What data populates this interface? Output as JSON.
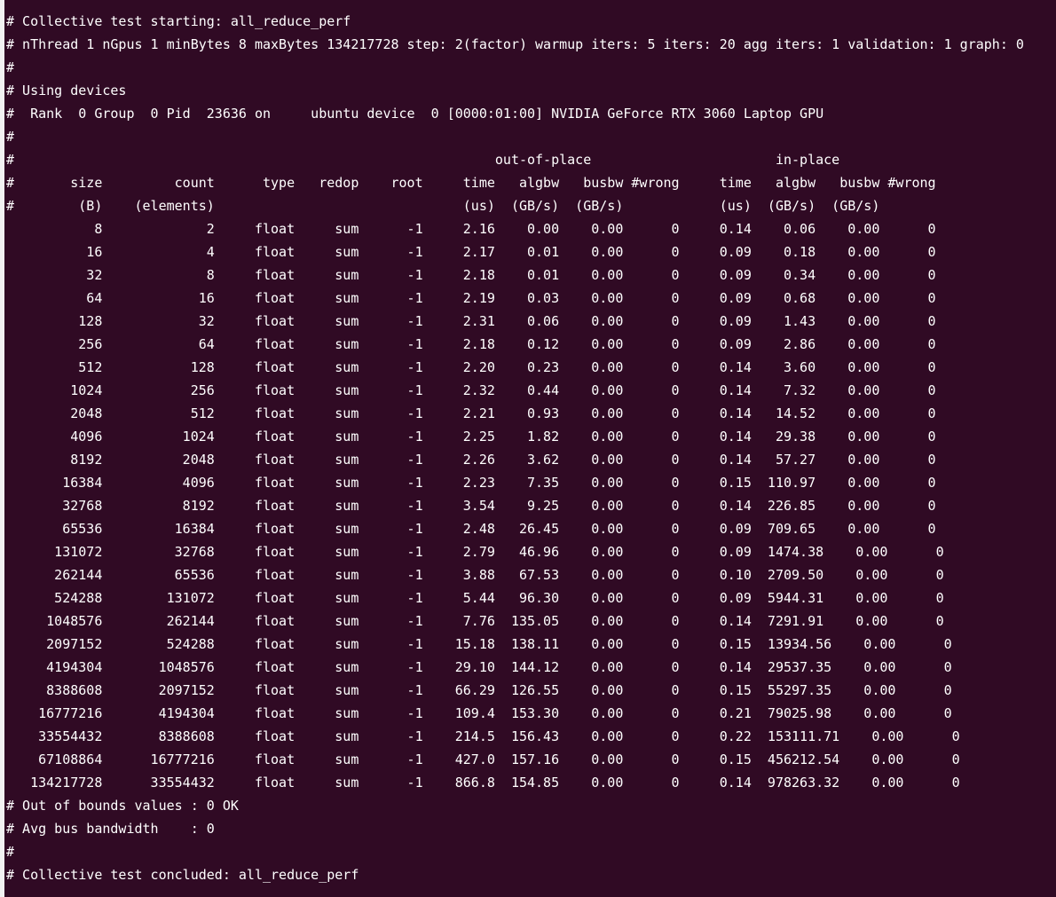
{
  "terminal": {
    "background": "#300a24",
    "foreground": "#ffffff",
    "lines": [
      "# Collective test starting: all_reduce_perf",
      "# nThread 1 nGpus 1 minBytes 8 maxBytes 134217728 step: 2(factor) warmup iters: 5 iters: 20 agg iters: 1 validation: 1 graph: 0",
      "#",
      "# Using devices",
      "#  Rank  0 Group  0 Pid  23636 on     ubuntu device  0 [0000:01:00] NVIDIA GeForce RTX 3060 Laptop GPU",
      "#",
      "#                                                            out-of-place                       in-place",
      "#       size         count      type   redop    root     time   algbw   busbw #wrong     time   algbw   busbw #wrong",
      "#        (B)    (elements)                               (us)  (GB/s)  (GB/s)            (us)  (GB/s)  (GB/s)",
      "           8             2     float     sum      -1     2.16    0.00    0.00      0     0.14    0.06    0.00      0",
      "          16             4     float     sum      -1     2.17    0.01    0.00      0     0.09    0.18    0.00      0",
      "          32             8     float     sum      -1     2.18    0.01    0.00      0     0.09    0.34    0.00      0",
      "          64            16     float     sum      -1     2.19    0.03    0.00      0     0.09    0.68    0.00      0",
      "         128            32     float     sum      -1     2.31    0.06    0.00      0     0.09    1.43    0.00      0",
      "         256            64     float     sum      -1     2.18    0.12    0.00      0     0.09    2.86    0.00      0",
      "         512           128     float     sum      -1     2.20    0.23    0.00      0     0.14    3.60    0.00      0",
      "        1024           256     float     sum      -1     2.32    0.44    0.00      0     0.14    7.32    0.00      0",
      "        2048           512     float     sum      -1     2.21    0.93    0.00      0     0.14   14.52    0.00      0",
      "        4096          1024     float     sum      -1     2.25    1.82    0.00      0     0.14   29.38    0.00      0",
      "        8192          2048     float     sum      -1     2.26    3.62    0.00      0     0.14   57.27    0.00      0",
      "       16384          4096     float     sum      -1     2.23    7.35    0.00      0     0.15  110.97    0.00      0",
      "       32768          8192     float     sum      -1     3.54    9.25    0.00      0     0.14  226.85    0.00      0",
      "       65536         16384     float     sum      -1     2.48   26.45    0.00      0     0.09  709.65    0.00      0",
      "      131072         32768     float     sum      -1     2.79   46.96    0.00      0     0.09  1474.38    0.00      0",
      "      262144         65536     float     sum      -1     3.88   67.53    0.00      0     0.10  2709.50    0.00      0",
      "      524288        131072     float     sum      -1     5.44   96.30    0.00      0     0.09  5944.31    0.00      0",
      "     1048576        262144     float     sum      -1     7.76  135.05    0.00      0     0.14  7291.91    0.00      0",
      "     2097152        524288     float     sum      -1    15.18  138.11    0.00      0     0.15  13934.56    0.00      0",
      "     4194304       1048576     float     sum      -1    29.10  144.12    0.00      0     0.14  29537.35    0.00      0",
      "     8388608       2097152     float     sum      -1    66.29  126.55    0.00      0     0.15  55297.35    0.00      0",
      "    16777216       4194304     float     sum      -1    109.4  153.30    0.00      0     0.21  79025.98    0.00      0",
      "    33554432       8388608     float     sum      -1    214.5  156.43    0.00      0     0.22  153111.71    0.00      0",
      "    67108864      16777216     float     sum      -1    427.0  157.16    0.00      0     0.15  456212.54    0.00      0",
      "   134217728      33554432     float     sum      -1    866.8  154.85    0.00      0     0.14  978263.32    0.00      0",
      "# Out of bounds values : 0 OK",
      "# Avg bus bandwidth    : 0",
      "#",
      "# Collective test concluded: all_reduce_perf"
    ]
  }
}
